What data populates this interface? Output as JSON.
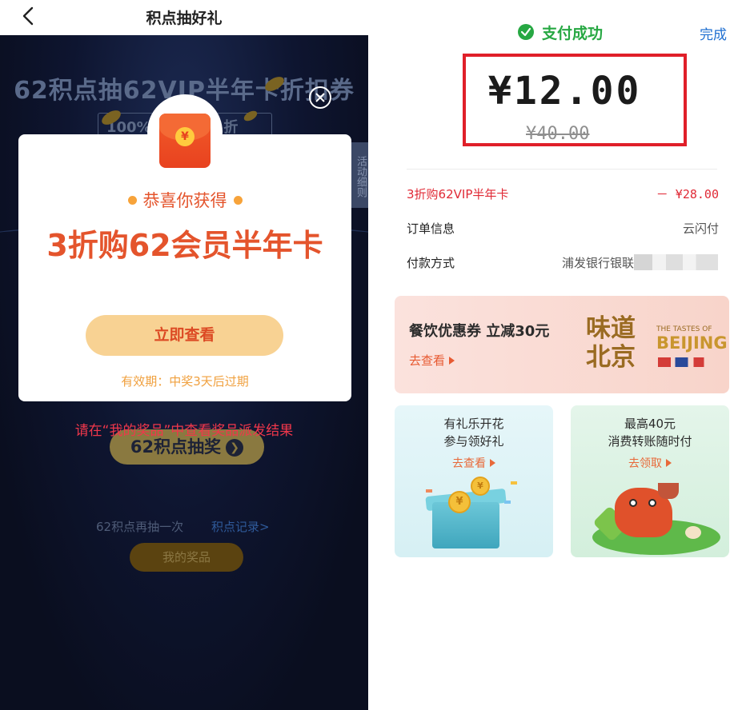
{
  "left": {
    "header": {
      "title": "积点抽好礼"
    },
    "background": {
      "banner_title": "62积点抽62VIP半年卡折扣券",
      "banner_sub": "100%中奖 最低1折",
      "rules_tab": "活动细则",
      "draw_button": "62积点抽奖",
      "draw_again": "62积点再抽一次",
      "points_record": "积点记录>",
      "my_prizes_button": "我的奖品"
    },
    "modal": {
      "coin_symbol": "¥",
      "congrats": "恭喜你获得",
      "prize_name": "3折购62会员半年卡",
      "view_button": "立即查看",
      "validity": "有效期：中奖3天后过期"
    },
    "notice": "请在“我的奖品”中查看奖品派发结果"
  },
  "right": {
    "status": "支付成功",
    "done": "完成",
    "amount": "¥12.00",
    "original_amount": "¥40.00",
    "rows": [
      {
        "label": "3折购62VIP半年卡",
        "value": "－ ¥28.00"
      },
      {
        "label": "订单信息",
        "value": "云闪付"
      },
      {
        "label": "付款方式",
        "value": "浦发银行银联"
      }
    ],
    "coupon": {
      "title": "餐饮优惠券 立减30元",
      "link": "去查看",
      "logo_cn_line1": "味道",
      "logo_cn_line2": "北京",
      "logo_en_small": "THE TASTES OF",
      "logo_en_big": "BEIJING"
    },
    "cards": [
      {
        "line1": "有礼乐开花",
        "line2": "参与领好礼",
        "link": "去查看"
      },
      {
        "line1": "最高40元",
        "line2": "消费转账随时付",
        "link": "去领取"
      }
    ]
  },
  "colors": {
    "accent_red": "#e4542c",
    "success_green": "#27a843",
    "link_blue": "#1f6fd1",
    "highlight_border": "#e01f29"
  }
}
